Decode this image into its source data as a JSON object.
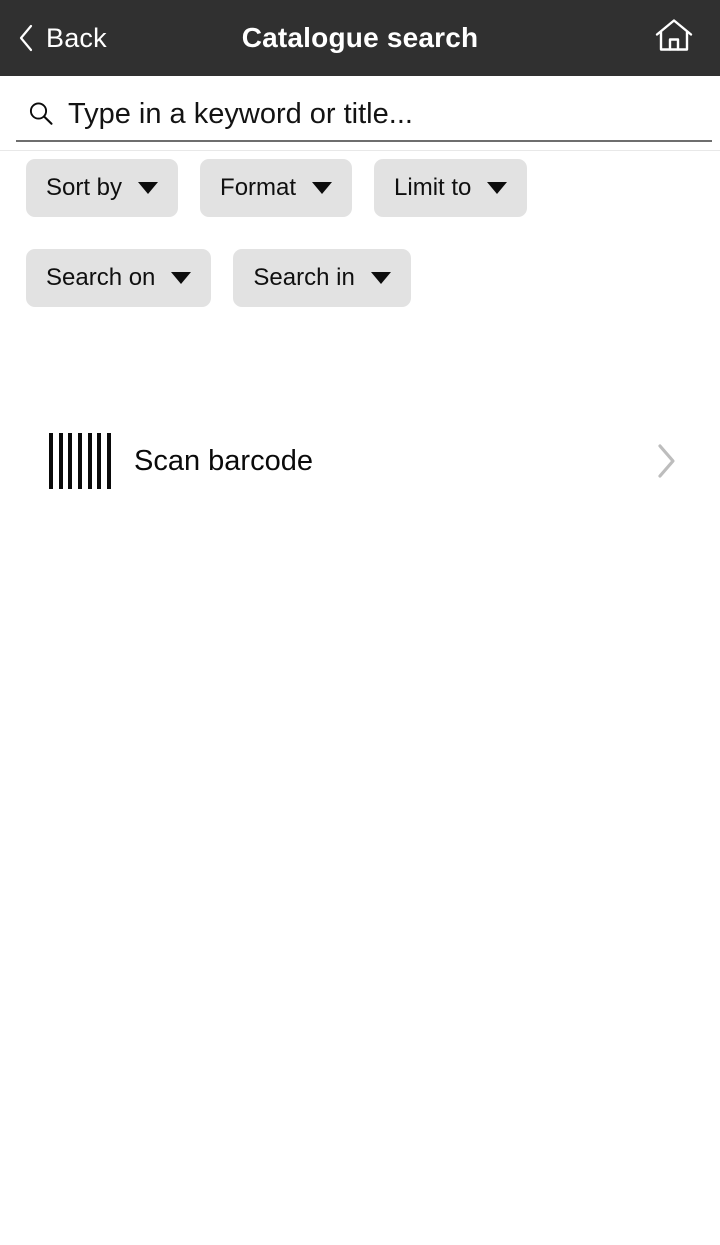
{
  "header": {
    "back_label": "Back",
    "title": "Catalogue search",
    "back_icon": "chevron-left-icon",
    "home_icon": "home-icon",
    "background_color": "#303030",
    "text_color": "#ffffff"
  },
  "search": {
    "placeholder": "Type in a keyword or title...",
    "value": "",
    "icon": "search-icon"
  },
  "filters": {
    "rows": [
      [
        {
          "label": "Sort by",
          "icon": "chevron-down-icon"
        },
        {
          "label": "Format",
          "icon": "chevron-down-icon"
        },
        {
          "label": "Limit to",
          "icon": "chevron-down-icon"
        }
      ],
      [
        {
          "label": "Search on",
          "icon": "chevron-down-icon"
        },
        {
          "label": "Search in",
          "icon": "chevron-down-icon"
        }
      ]
    ],
    "chip_background": "#e2e2e2",
    "chip_text_color": "#101010"
  },
  "scan": {
    "label": "Scan barcode",
    "icon": "barcode-icon",
    "accessory_icon": "chevron-right-icon",
    "accessory_color": "#bdbdbd"
  }
}
